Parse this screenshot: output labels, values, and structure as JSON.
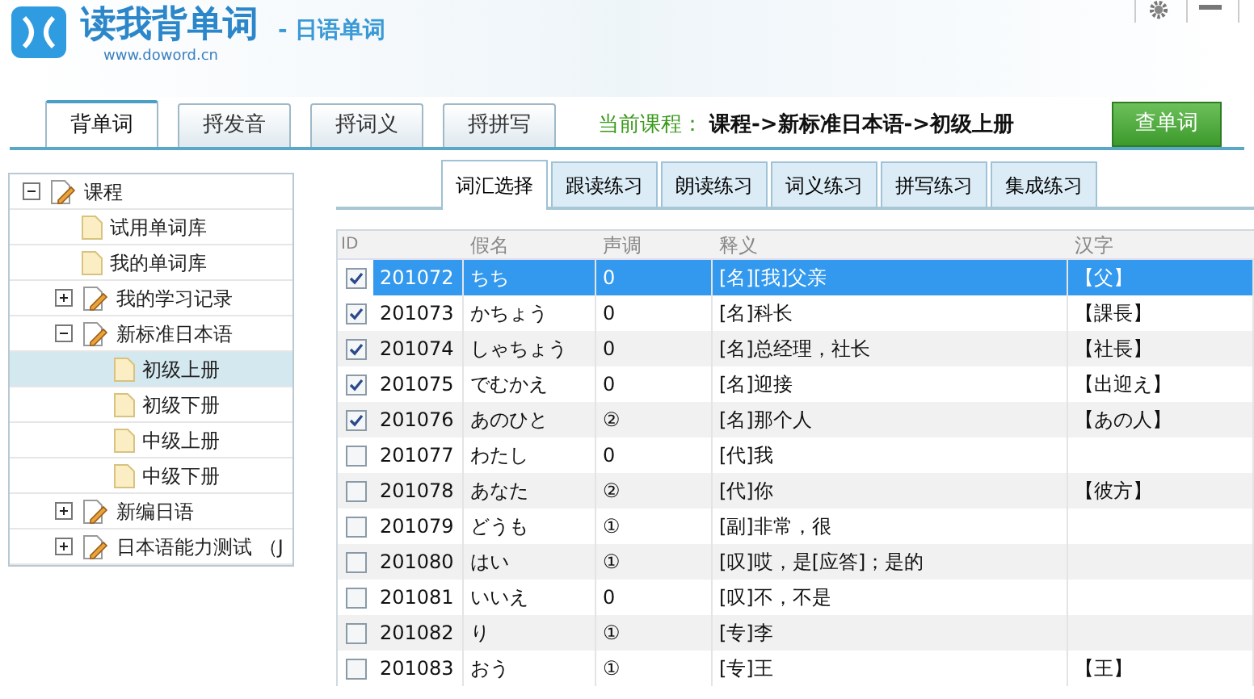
{
  "app": {
    "title": "读我背单词",
    "subtitle": "- 日语单词",
    "url": "www.doword.cn"
  },
  "main_tabs": [
    {
      "label": "背单词",
      "selected": true
    },
    {
      "label": "捋发音",
      "selected": false
    },
    {
      "label": "捋词义",
      "selected": false
    },
    {
      "label": "捋拼写",
      "selected": false
    }
  ],
  "current_course": {
    "label": "当前课程：",
    "path": "课程->新标准日本语->初级上册"
  },
  "lookup_button": "查单词",
  "tree": [
    {
      "label": "课程",
      "kind": "group",
      "expanded": true,
      "selected": false,
      "children": [
        {
          "label": "试用单词库",
          "kind": "leaf",
          "selected": false
        },
        {
          "label": "我的单词库",
          "kind": "leaf",
          "selected": false
        },
        {
          "label": "我的学习记录",
          "kind": "group",
          "expanded": false,
          "selected": false
        },
        {
          "label": "新标准日本语",
          "kind": "group",
          "expanded": true,
          "selected": false,
          "children": [
            {
              "label": "初级上册",
              "kind": "leaf",
              "selected": true
            },
            {
              "label": "初级下册",
              "kind": "leaf",
              "selected": false
            },
            {
              "label": "中级上册",
              "kind": "leaf",
              "selected": false
            },
            {
              "label": "中级下册",
              "kind": "leaf",
              "selected": false
            }
          ]
        },
        {
          "label": "新编日语",
          "kind": "group",
          "expanded": false,
          "selected": false
        },
        {
          "label": "日本语能力测试 （J",
          "kind": "group",
          "expanded": false,
          "selected": false
        }
      ]
    }
  ],
  "practice_tabs": [
    {
      "label": "词汇选择",
      "selected": true
    },
    {
      "label": "跟读练习",
      "selected": false
    },
    {
      "label": "朗读练习",
      "selected": false
    },
    {
      "label": "词义练习",
      "selected": false
    },
    {
      "label": "拼写练习",
      "selected": false
    },
    {
      "label": "集成练习",
      "selected": false
    }
  ],
  "table": {
    "columns": [
      "ID",
      "假名",
      "声调",
      "释义",
      "汉字"
    ],
    "rows": [
      {
        "checked": true,
        "selected": true,
        "cells": [
          "201072",
          "ちち",
          "0",
          "[名][我]父亲",
          "【父】"
        ]
      },
      {
        "checked": true,
        "selected": false,
        "cells": [
          "201073",
          "かちょう",
          "0",
          "[名]科长",
          "【課長】"
        ]
      },
      {
        "checked": true,
        "selected": false,
        "cells": [
          "201074",
          "しゃちょう",
          "0",
          "[名]总经理，社长",
          "【社長】"
        ]
      },
      {
        "checked": true,
        "selected": false,
        "cells": [
          "201075",
          "でむかえ",
          "0",
          "[名]迎接",
          "【出迎え】"
        ]
      },
      {
        "checked": true,
        "selected": false,
        "cells": [
          "201076",
          "あのひと",
          "②",
          "[名]那个人",
          "【あの人】"
        ]
      },
      {
        "checked": false,
        "selected": false,
        "cells": [
          "201077",
          "わたし",
          "0",
          "[代]我",
          ""
        ]
      },
      {
        "checked": false,
        "selected": false,
        "cells": [
          "201078",
          "あなた",
          "②",
          "[代]你",
          "【彼方】"
        ]
      },
      {
        "checked": false,
        "selected": false,
        "cells": [
          "201079",
          "どうも",
          "①",
          "[副]非常，很",
          ""
        ]
      },
      {
        "checked": false,
        "selected": false,
        "cells": [
          "201080",
          "はい",
          "①",
          "[叹]哎，是[应答]；是的",
          ""
        ]
      },
      {
        "checked": false,
        "selected": false,
        "cells": [
          "201081",
          "いいえ",
          "0",
          "[叹]不，不是",
          ""
        ]
      },
      {
        "checked": false,
        "selected": false,
        "cells": [
          "201082",
          "り",
          "①",
          "[专]李",
          ""
        ]
      },
      {
        "checked": false,
        "selected": false,
        "cells": [
          "201083",
          "おう",
          "①",
          "[专]王",
          "【王】"
        ]
      }
    ]
  }
}
